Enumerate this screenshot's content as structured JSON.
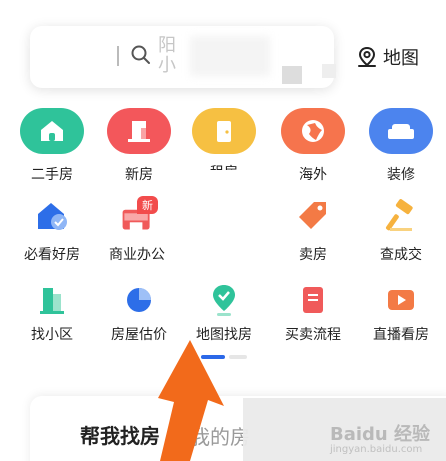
{
  "search": {
    "placeholder": "阳\n小"
  },
  "map_button": {
    "label": "地图"
  },
  "row1": [
    {
      "label": "二手房",
      "icon": "house-icon",
      "color": "#2fc39a"
    },
    {
      "label": "新房",
      "icon": "building-icon",
      "color": "#f3575b"
    },
    {
      "label": "租房",
      "icon": "door-icon",
      "color": "#f6c042"
    },
    {
      "label": "海外",
      "icon": "globe-icon",
      "color": "#f6744d"
    },
    {
      "label": "装修",
      "icon": "sofa-icon",
      "color": "#4c84ee"
    }
  ],
  "row2": [
    {
      "label": "必看好房",
      "icon": "house-heart-icon"
    },
    {
      "label": "商业办公",
      "icon": "shop-icon",
      "badge": "新"
    },
    {
      "label": "卖房",
      "icon": "tag-icon"
    },
    {
      "label": "查成交",
      "icon": "hammer-icon"
    }
  ],
  "row3": [
    {
      "label": "找小区",
      "icon": "community-icon"
    },
    {
      "label": "房屋估价",
      "icon": "pie-chart-icon"
    },
    {
      "label": "地图找房",
      "icon": "map-pin-icon"
    },
    {
      "label": "买卖流程",
      "icon": "document-icon"
    },
    {
      "label": "直播看房",
      "icon": "live-video-icon"
    }
  ],
  "bottom_tabs": {
    "help": "帮我找房",
    "mine": "我的房"
  },
  "watermark": {
    "title": "Baidu 经验",
    "sub": "jingyan.baidu.com"
  },
  "colors": {
    "accent_blue": "#2b68e8",
    "arrow_orange": "#f26a1b"
  }
}
